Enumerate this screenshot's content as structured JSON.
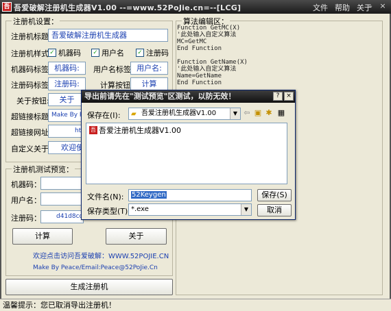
{
  "window": {
    "title": "吾爱破解注册机生成器V1.00   --=www.52PoJie.cn=--[LCG]",
    "menu": [
      "文件",
      "帮助",
      "关于"
    ],
    "icon_glyph": "吾"
  },
  "settings_group": {
    "title": "注册机设置：",
    "keygen_title_label": "注册机标题:",
    "keygen_title_value": "吾爱破解注册机生成器",
    "style_label": "注册机样式:",
    "checkboxes": [
      "机器码",
      "用户名",
      "注册码"
    ],
    "machine_label": "机器码标签:",
    "machine_value": "机器码:",
    "username_label": "用户名标签:",
    "username_value": "用户名:",
    "regcode_label": "注册码标签:",
    "regcode_value": "注册码:",
    "calc_label": "计算按钮:",
    "calc_value": "计算",
    "about_btn_label": "关于按钮:",
    "about_btn_value": "关于",
    "hyperlink_title_label": "超链接标题:",
    "hyperlink_title_value": "Make By Pe",
    "hyperlink_url_label": "超链接网址:",
    "hyperlink_url_value": "ht",
    "custom_about_label": "自定义关于:",
    "custom_about_value": "欢迎使用"
  },
  "test_group": {
    "title": "注册机测试预览：",
    "machine_label": "机器码：",
    "username_label": "用户名：",
    "regcode_label": "注册码：",
    "regcode_value": "d41d8cd98",
    "calc_button": "计算",
    "about_button": "关于",
    "link_text": "欢迎点击访问吾爱破解：WWW.52POJIE.CN",
    "make_by": "Make By Peace/Email:Peace@52PoJie.Cn"
  },
  "generate_button": "生成注册机",
  "algo": {
    "title": "算法编辑区：",
    "code": "Function GetMC(X)\n'此处输入自定义算法\nMC=GetMC\nEnd Function\n\nFunction GetName(X)\n'此处输入自定义算法\nName=GetName\nEnd Function\n\nFunction GetSN()"
  },
  "status": {
    "text": "温馨提示：您已取消导出注册机！"
  },
  "dialog": {
    "title": "导出前请先在\"测试预览\"区测试，以防无效！",
    "help_btn": "?",
    "close_btn": "×",
    "save_in_label": "保存在(I):",
    "save_in_value": "吾爱注册机生成器V1.00",
    "files": [
      "吾爱注册机生成器V1.00"
    ],
    "filename_label": "文件名(N):",
    "filename_value": "52Keygen",
    "filetype_label": "保存类型(T):",
    "filetype_value": "*.exe",
    "save_button": "保存(S)",
    "cancel_button": "取消"
  }
}
